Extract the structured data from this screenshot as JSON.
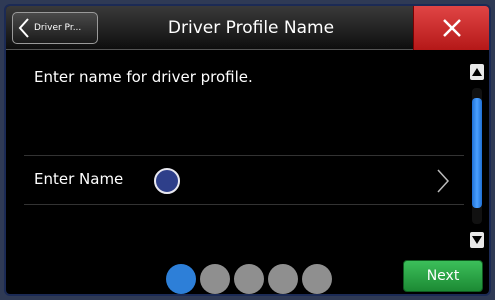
{
  "header": {
    "back_label": "Driver Pr...",
    "title": "Driver Profile Name"
  },
  "main": {
    "prompt": "Enter name for driver profile.",
    "field_label": "Enter Name"
  },
  "pager": {
    "page_count": 5,
    "current_page": 1
  },
  "footer": {
    "next_label": "Next"
  },
  "colors": {
    "close_red": "#d32f2f",
    "next_green": "#2ea64a",
    "accent_blue": "#2d7fd8"
  }
}
